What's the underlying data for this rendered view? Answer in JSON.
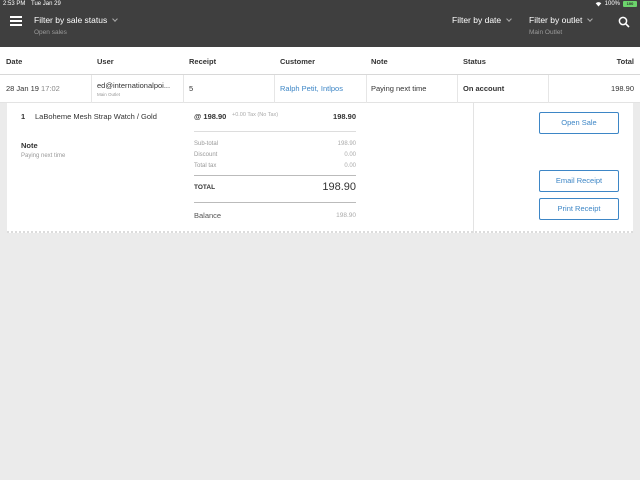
{
  "status_bar": {
    "time": "2:53 PM",
    "date": "Tue Jan 29",
    "battery": "100%",
    "battery_level": "100"
  },
  "top_bar": {
    "filter_status": {
      "label": "Filter by sale status",
      "value": "Open sales"
    },
    "filter_date": {
      "label": "Filter by date"
    },
    "filter_outlet": {
      "label": "Filter by outlet",
      "value": "Main Outlet"
    }
  },
  "table": {
    "columns": [
      "Date",
      "User",
      "Receipt",
      "Customer",
      "Note",
      "Status",
      "Total"
    ],
    "row": {
      "date": "28 Jan 19",
      "time": "17:02",
      "user": "ed@internationalpoi...",
      "user_outlet": "Main Outlet",
      "receipt": "5",
      "customer": "Ralph Petit, Intlpos",
      "note": "Paying next time",
      "status": "On account",
      "total": "198.90"
    }
  },
  "detail": {
    "line_item": {
      "qty": "1",
      "name": "LaBoheme Mesh Strap Watch / Gold",
      "unit_price": "@ 198.90",
      "tax": "+0.00 Tax (No Tax)",
      "total": "198.90"
    },
    "note_heading": "Note",
    "note_text": "Paying next time",
    "subtotal_label": "Sub-total",
    "subtotal": "198.90",
    "discount_label": "Discount",
    "discount": "0.00",
    "totaltax_label": "Total tax",
    "totaltax": "0.00",
    "total_label": "TOTAL",
    "total": "198.90",
    "balance_label": "Balance",
    "balance": "198.90",
    "buttons": {
      "open_sale": "Open Sale",
      "email_receipt": "Email Receipt",
      "print_receipt": "Print Receipt"
    }
  },
  "colors": {
    "topbar": "#3f3f3f",
    "accent": "#3d86c6",
    "battery": "#6cd46c"
  },
  "icons": [
    "menu-icon",
    "chevron-down-icon",
    "search-icon",
    "wifi-icon",
    "battery-icon"
  ]
}
